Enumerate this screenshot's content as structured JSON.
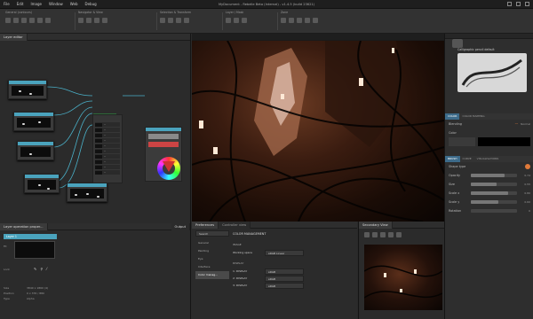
{
  "menubar": {
    "items": [
      "File",
      "Edit",
      "Image",
      "Window",
      "Web",
      "Debug"
    ],
    "title": "MyDocument - Rebelle Beta (Internal) - v1.4.5 (build 23621)"
  },
  "toolbar": {
    "groups": [
      "General (contours)",
      "Navigator & View",
      "Selection & Transform",
      "Layer / Mask",
      "Zone"
    ]
  },
  "node_panel": {
    "tab": "Layer editor",
    "output_label": "Output"
  },
  "layer_panel": {
    "tab": "Layer operation proper...",
    "layer_name": "Layer 1",
    "extra_tab": "Output",
    "labels": [
      "Fit",
      "Lock"
    ],
    "info": [
      [
        "Size",
        "3840 x 1860 (4)"
      ],
      [
        "Position",
        "0 x 376 / 880"
      ],
      [
        "Type",
        "Alpha"
      ]
    ]
  },
  "preferences": {
    "tab": "Preferences",
    "tab2": "Controller view",
    "search_placeholder": "Search",
    "side_items": [
      "General",
      "Painting",
      "Eye",
      "Interface",
      "Color manag..."
    ],
    "section_title": "COLOR MANAGEMENT",
    "subsections": [
      {
        "label": "IMAGE",
        "rows": [
          [
            "Working space",
            "sRGB Linear"
          ]
        ]
      },
      {
        "label": "DISPLAY",
        "rows": [
          [
            "1: DISPLAY",
            "sRGB"
          ],
          [
            "2: DISPLAY",
            "sRGB"
          ],
          [
            "3: DISPLAY",
            "sRGB"
          ]
        ]
      }
    ]
  },
  "secondary": {
    "tab": "Secondary View"
  },
  "right_panel": {
    "brush_name": "Calligraphic pencil default",
    "section1_tabs": [
      "COLOR",
      "COLOR MAPPING"
    ],
    "blending_label": "Blending",
    "blend_mode": "Normal",
    "color_label": "Color",
    "section2_tabs": [
      "BRUSH",
      "CURVE",
      "VISUALISATIONS"
    ],
    "shape_label": "Shape type",
    "params": [
      {
        "label": "Opacity",
        "value": "0.74",
        "fill": 0.74
      },
      {
        "label": "Size",
        "value": "0.55",
        "fill": 0.55
      },
      {
        "label": "Scale x",
        "value": "0.80",
        "fill": 0.8
      },
      {
        "label": "Scale y",
        "value": "0.60",
        "fill": 0.6
      },
      {
        "label": "Rotation",
        "value": "0",
        "fill": 0.0
      }
    ],
    "accent": "#e07a3a"
  }
}
